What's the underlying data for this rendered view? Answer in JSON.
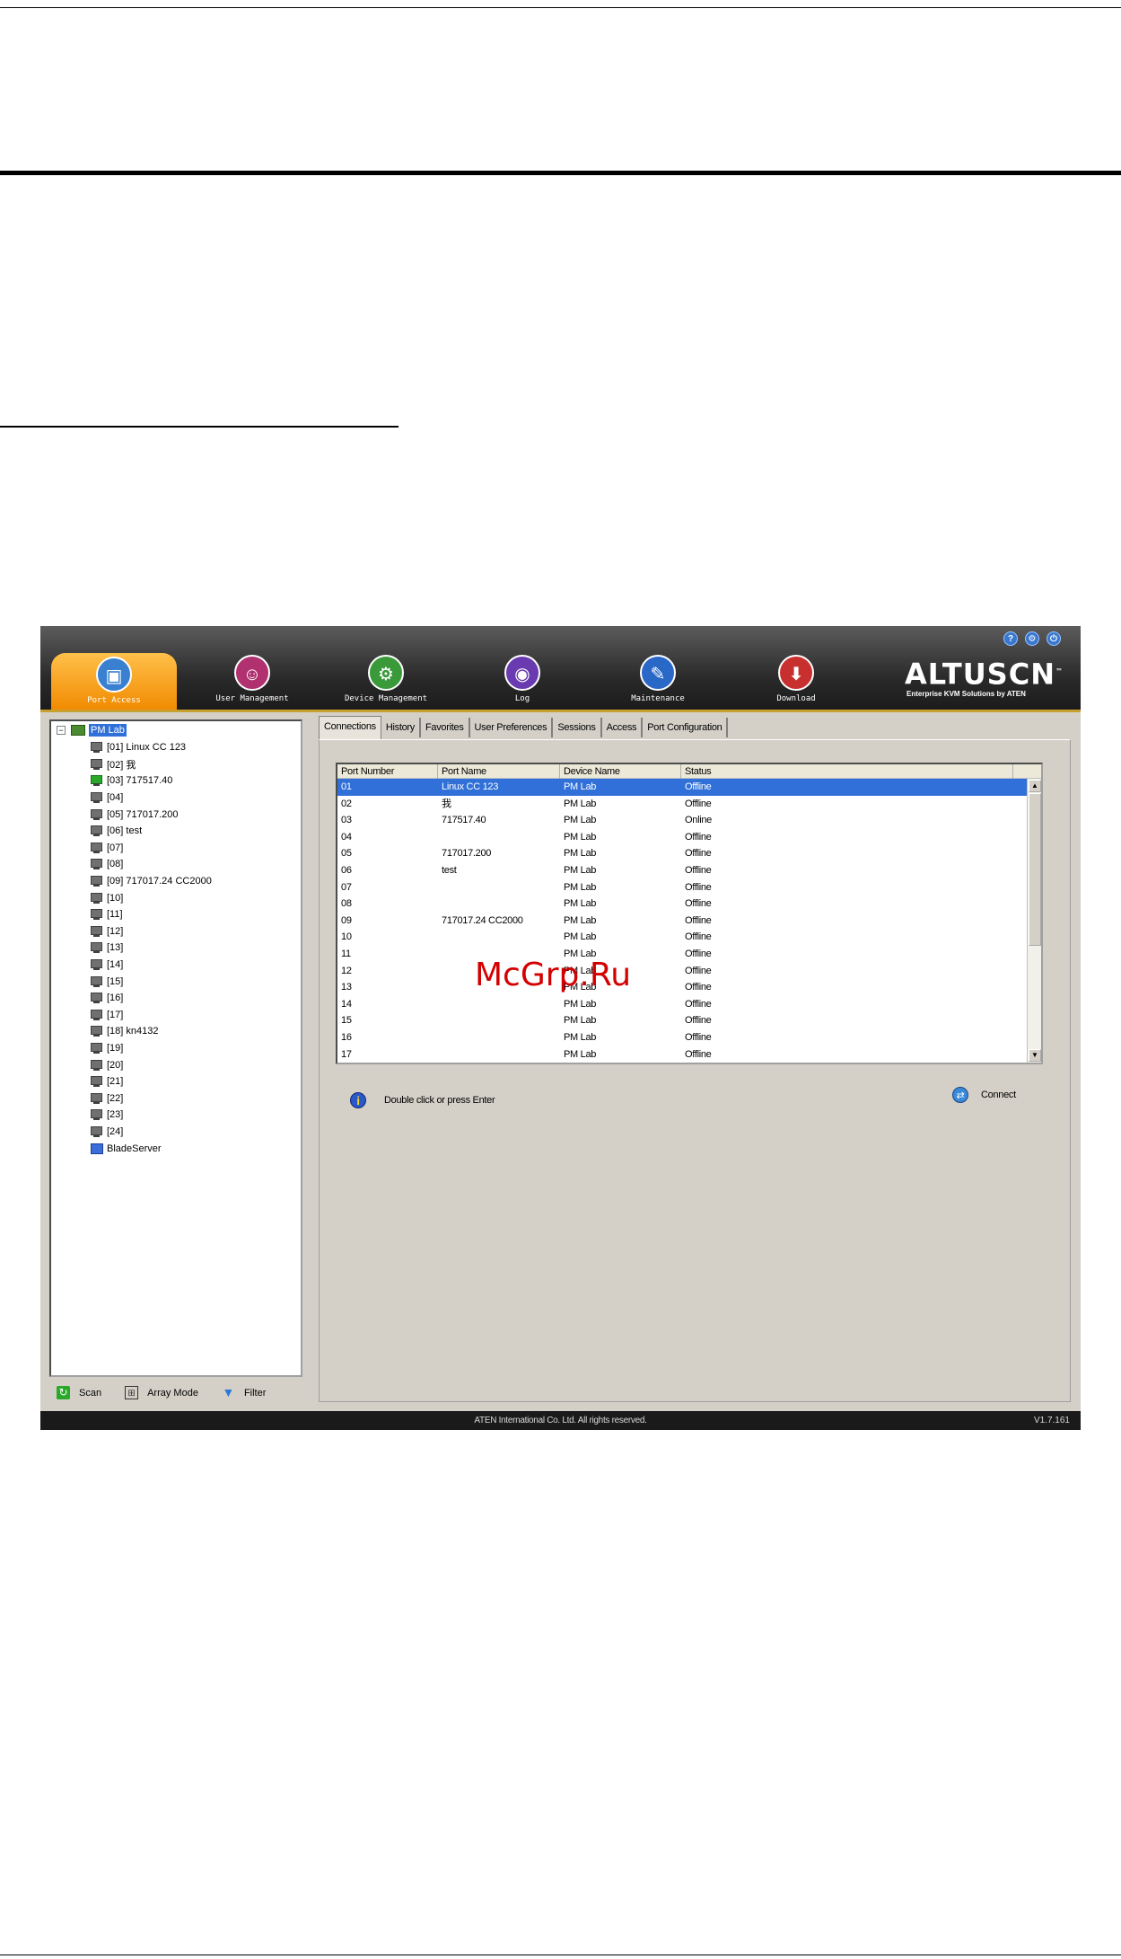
{
  "app": {
    "nav": [
      {
        "label": "Port Access",
        "icon": "port-access-icon",
        "color": "#3a80d0",
        "active": true
      },
      {
        "label": "User Management",
        "icon": "user-management-icon",
        "color": "#b03070"
      },
      {
        "label": "Device Management",
        "icon": "device-management-icon",
        "color": "#3a9a3a"
      },
      {
        "label": "Log",
        "icon": "log-icon",
        "color": "#6a3ab0"
      },
      {
        "label": "Maintenance",
        "icon": "maintenance-icon",
        "color": "#2a68c8"
      },
      {
        "label": "Download",
        "icon": "download-icon",
        "color": "#c83030"
      }
    ],
    "logo": {
      "name": "ALTUSCN",
      "tm": "™",
      "tagline": "Enterprise KVM Solutions by ATEN"
    },
    "window_buttons": [
      "help-icon",
      "settings-icon",
      "logout-icon"
    ],
    "tree": {
      "root": "PM Lab",
      "items": [
        {
          "label": "[01] Linux CC 123",
          "status": "offline"
        },
        {
          "label": "[02] 我",
          "status": "offline"
        },
        {
          "label": "[03] 717517.40",
          "status": "online"
        },
        {
          "label": "[04]",
          "status": "offline"
        },
        {
          "label": "[05] 717017.200",
          "status": "offline"
        },
        {
          "label": "[06] test",
          "status": "offline"
        },
        {
          "label": "[07]",
          "status": "offline"
        },
        {
          "label": "[08]",
          "status": "offline"
        },
        {
          "label": "[09] 717017.24 CC2000",
          "status": "offline"
        },
        {
          "label": "[10]",
          "status": "offline"
        },
        {
          "label": "[11]",
          "status": "offline"
        },
        {
          "label": "[12]",
          "status": "offline"
        },
        {
          "label": "[13]",
          "status": "offline"
        },
        {
          "label": "[14]",
          "status": "offline"
        },
        {
          "label": "[15]",
          "status": "offline"
        },
        {
          "label": "[16]",
          "status": "offline"
        },
        {
          "label": "[17]",
          "status": "offline"
        },
        {
          "label": "[18] kn4132",
          "status": "offline"
        },
        {
          "label": "[19]",
          "status": "offline"
        },
        {
          "label": "[20]",
          "status": "offline"
        },
        {
          "label": "[21]",
          "status": "offline"
        },
        {
          "label": "[22]",
          "status": "offline"
        },
        {
          "label": "[23]",
          "status": "offline"
        },
        {
          "label": "[24]",
          "status": "offline"
        },
        {
          "label": "BladeServer",
          "status": "blade"
        }
      ]
    },
    "left_tools": {
      "scan": "Scan",
      "array_mode": "Array Mode",
      "filter": "Filter"
    },
    "tabs": [
      "Connections",
      "History",
      "Favorites",
      "User Preferences",
      "Sessions",
      "Access",
      "Port Configuration"
    ],
    "table": {
      "headers": [
        "Port Number",
        "Port Name",
        "Device Name",
        "Status"
      ],
      "rows": [
        [
          "01",
          "Linux CC 123",
          "PM Lab",
          "Offline"
        ],
        [
          "02",
          "我",
          "PM Lab",
          "Offline"
        ],
        [
          "03",
          "717517.40",
          "PM Lab",
          "Online"
        ],
        [
          "04",
          "",
          "PM Lab",
          "Offline"
        ],
        [
          "05",
          "717017.200",
          "PM Lab",
          "Offline"
        ],
        [
          "06",
          "test",
          "PM Lab",
          "Offline"
        ],
        [
          "07",
          "",
          "PM Lab",
          "Offline"
        ],
        [
          "08",
          "",
          "PM Lab",
          "Offline"
        ],
        [
          "09",
          "717017.24 CC2000",
          "PM Lab",
          "Offline"
        ],
        [
          "10",
          "",
          "PM Lab",
          "Offline"
        ],
        [
          "11",
          "",
          "PM Lab",
          "Offline"
        ],
        [
          "12",
          "",
          "PM Lab",
          "Offline"
        ],
        [
          "13",
          "",
          "PM Lab",
          "Offline"
        ],
        [
          "14",
          "",
          "PM Lab",
          "Offline"
        ],
        [
          "15",
          "",
          "PM Lab",
          "Offline"
        ],
        [
          "16",
          "",
          "PM Lab",
          "Offline"
        ],
        [
          "17",
          "",
          "PM Lab",
          "Offline"
        ]
      ],
      "selected_index": 0
    },
    "hint": "Double click or press Enter",
    "connect": "Connect",
    "status_bar": {
      "copyright": "ATEN International Co. Ltd. All rights reserved.",
      "version": "V1.7.161"
    }
  },
  "watermark": "McGrp.Ru"
}
